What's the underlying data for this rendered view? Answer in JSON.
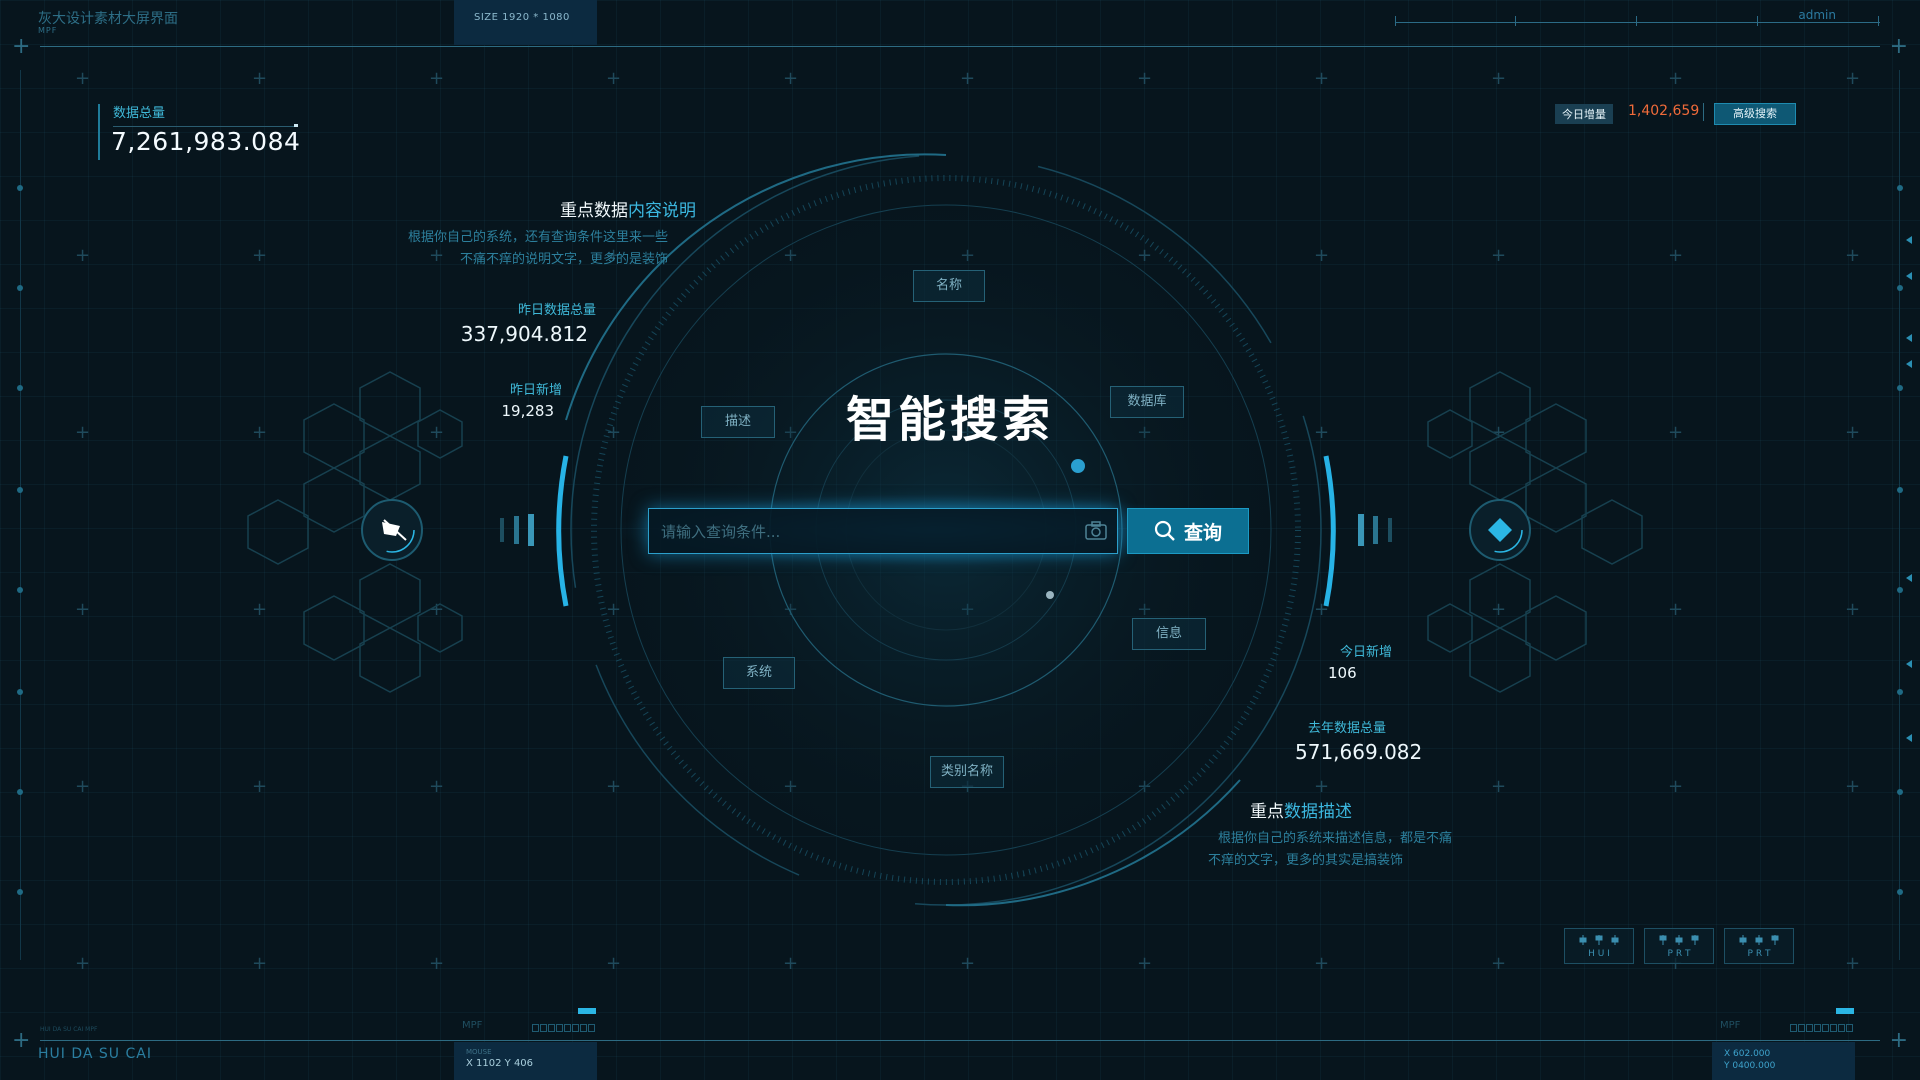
{
  "header": {
    "app_title": "灰大设计素材大屏界面",
    "app_sub": "MPF",
    "size_label": "SIZE 1920 * 1080",
    "user": "admin"
  },
  "top_left": {
    "label": "数据总量",
    "value": "7,261,983.084"
  },
  "top_right": {
    "today_label": "今日增量",
    "today_value": "1,402,659",
    "advanced_search_label": "高级搜索"
  },
  "left_panel": {
    "note_title_white": "重点数据",
    "note_title_cyan": "内容说明",
    "note_desc_line1": "根据你自己的系统，还有查询条件这里来一些",
    "note_desc_line2": "不痛不痒的说明文字，更多的是装饰",
    "yesterday_total_label": "昨日数据总量",
    "yesterday_total_value": "337,904.812",
    "yesterday_new_label": "昨日新增",
    "yesterday_new_value": "19,283"
  },
  "right_panel": {
    "today_new_label": "今日新增",
    "today_new_value": "106",
    "last_year_label": "去年数据总量",
    "last_year_value": "571,669.082",
    "note_title_white": "重点",
    "note_title_cyan": "数据描述",
    "note_desc_line1": "根据你自己的系统来描述信息，都是不痛",
    "note_desc_line2": "不痒的文字，更多的其实是搞装饰"
  },
  "center": {
    "title": "智能搜索",
    "tags": {
      "name": "名称",
      "database": "数据库",
      "describe": "描述",
      "info": "信息",
      "system": "系统",
      "category": "类别名称"
    },
    "search": {
      "placeholder": "请输入查询条件...",
      "button_label": "查询"
    }
  },
  "mini_buttons": [
    {
      "label": "H U I"
    },
    {
      "label": "P R T"
    },
    {
      "label": "P R T"
    }
  ],
  "footer": {
    "brand": "HUI DA SU CAI",
    "tiny_text": "HUI DA SU CAI MPF",
    "mpf_left": "MPF",
    "mpf_right": "MPF",
    "mouse_label": "MOUSE",
    "mouse_coords": "X 1102  Y 406",
    "x_readout": "X 602.000",
    "y_readout": "Y 0400.000"
  },
  "colors": {
    "background": "#07151d",
    "accent": "#2bb6e4",
    "highlight": "#f06b3a",
    "text": "#cfe9f3"
  }
}
